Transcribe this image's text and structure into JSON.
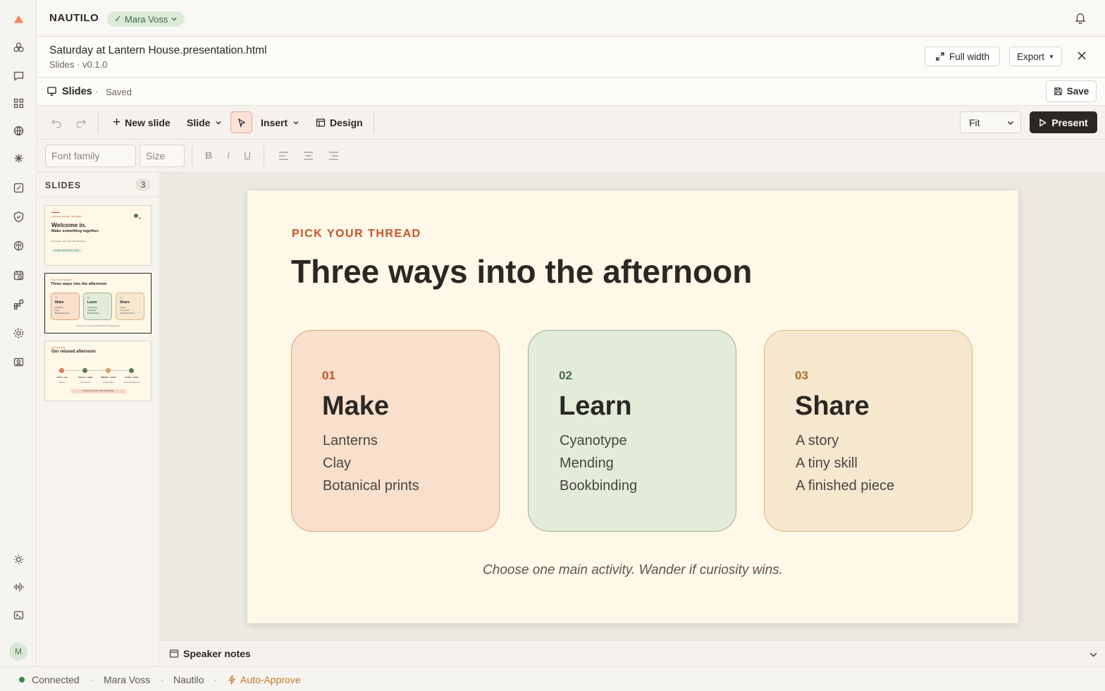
{
  "app": {
    "brand": "NAUTILO",
    "user": "Mara Voss",
    "avatar_initial": "M"
  },
  "file": {
    "name": "Saturday at Lantern House.presentation.html",
    "meta": "Slides · v0.1.0",
    "full_width_label": "Full width",
    "export_label": "Export"
  },
  "savebar": {
    "title": "Slides",
    "status": "Saved",
    "save_label": "Save"
  },
  "toolbar": {
    "new_slide": "New slide",
    "slide": "Slide",
    "insert": "Insert",
    "design": "Design",
    "zoom": "Fit",
    "present": "Present"
  },
  "format": {
    "font_placeholder": "Font family",
    "size_placeholder": "Size",
    "bold": "B",
    "italic": "I",
    "underline": "U"
  },
  "panel": {
    "title": "SLIDES",
    "count": "3"
  },
  "thumbs": [
    {
      "kicker": "LANTERN HOUSE · SATURDAY",
      "title": "Welcome in.",
      "subtitle": "Make something together.",
      "line": "Six people. One unhurried afternoon.",
      "pill": "Arrivals, materials set, no rush"
    },
    {
      "kicker": "PICK YOUR THREAD",
      "title": "Three ways into the afternoon",
      "cards": [
        {
          "num": "01",
          "title": "Make",
          "items": [
            "Lanterns",
            "Clay",
            "Botanical prints"
          ]
        },
        {
          "num": "02",
          "title": "Learn",
          "items": [
            "Cyanotype",
            "Mending",
            "Bookbinding"
          ]
        },
        {
          "num": "03",
          "title": "Share",
          "items": [
            "A story",
            "A tiny skill",
            "A finished piece"
          ]
        }
      ],
      "footer": "Choose one main activity. Wander if curiosity wins."
    },
    {
      "kicker": "AT A GLANCE",
      "title": "Our relaxed afternoon",
      "steps": [
        {
          "title": "Arrive + tea",
          "sub": "Settle in"
        },
        {
          "title": "Choose + make",
          "sub": "Pick a thread"
        },
        {
          "title": "Wander + snack",
          "sub": "Change tables"
        },
        {
          "title": "Finish + share",
          "sub": "Show what happened"
        }
      ],
      "footer": "The time is a guide, not a big schedule."
    }
  ],
  "slide": {
    "kicker": "PICK YOUR THREAD",
    "title": "Three ways into the afternoon",
    "cards": [
      {
        "num": "01",
        "title": "Make",
        "items": [
          "Lanterns",
          "Clay",
          "Botanical prints"
        ],
        "bg": "#f8e0cc",
        "border": "#e0a27a",
        "accent": "#c4532a"
      },
      {
        "num": "02",
        "title": "Learn",
        "items": [
          "Cyanotype",
          "Mending",
          "Bookbinding"
        ],
        "bg": "#e2ecd9",
        "border": "#9bb392",
        "accent": "#4f6a4c"
      },
      {
        "num": "03",
        "title": "Share",
        "items": [
          "A story",
          "A tiny skill",
          "A finished piece"
        ],
        "bg": "#f6e7cf",
        "border": "#d9b77c",
        "accent": "#b06a1e"
      }
    ],
    "footer": "Choose one main activity. Wander if curiosity wins."
  },
  "notes": {
    "label": "Speaker notes"
  },
  "status": {
    "connection": "Connected",
    "user": "Mara Voss",
    "app": "Nautilo",
    "mode": "Auto-Approve"
  },
  "colors": {
    "accent": "#c4532a",
    "connected": "#3a8a44",
    "present_bg": "#2b2824"
  }
}
